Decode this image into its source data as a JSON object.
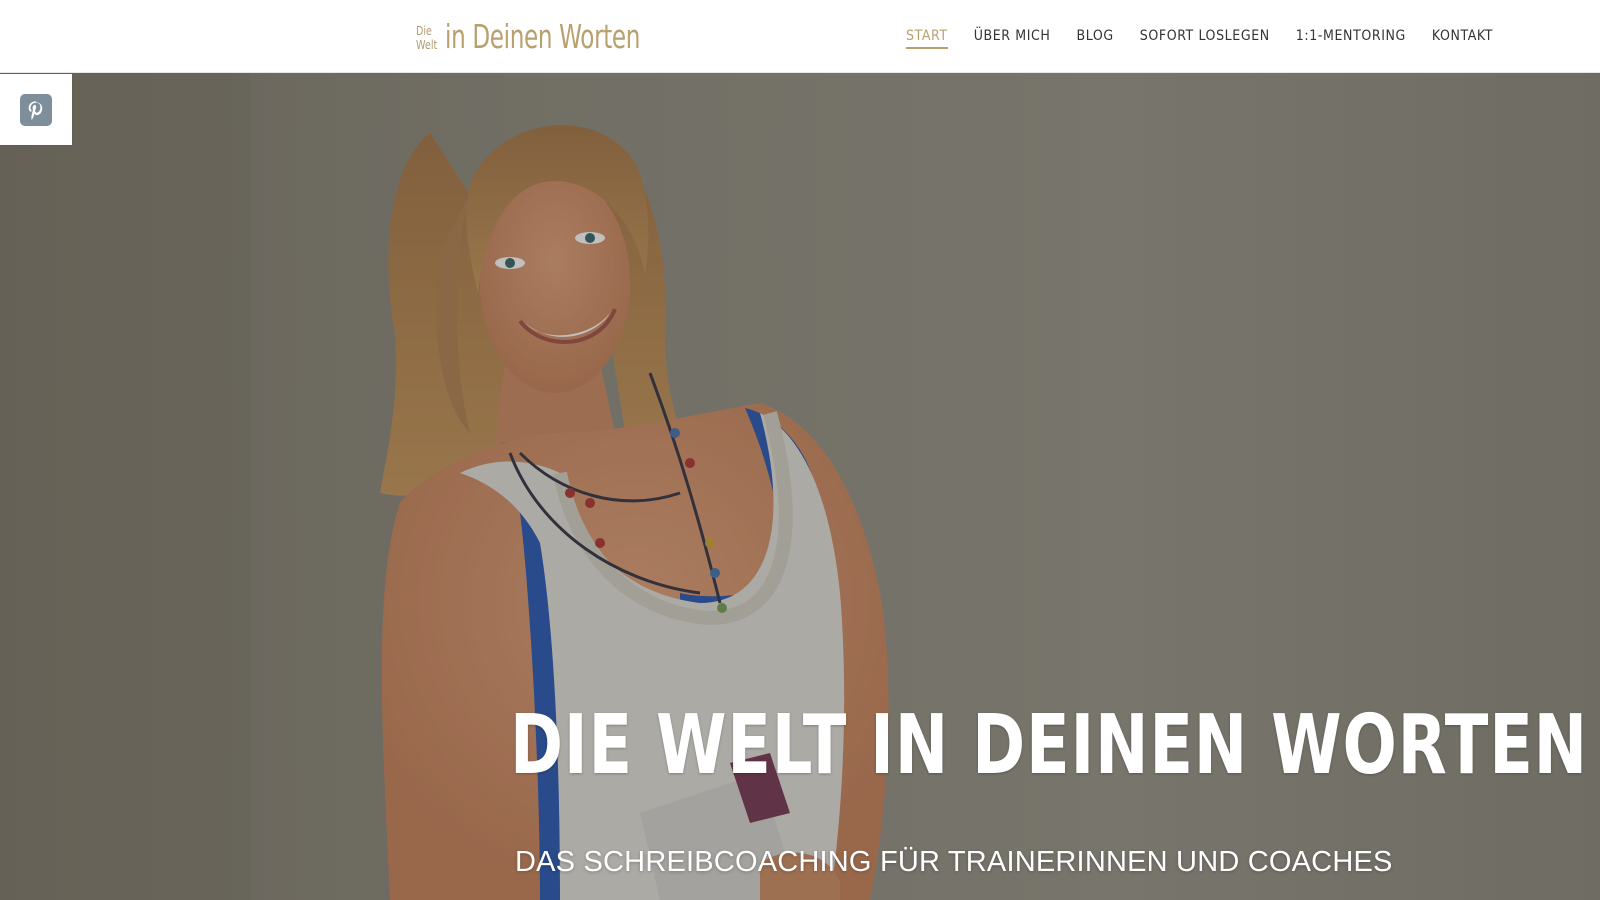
{
  "header": {
    "logo": {
      "small_line1": "Die",
      "small_line2": "Welt",
      "main": "in Deinen Worten"
    },
    "nav": [
      {
        "label": "START",
        "active": true
      },
      {
        "label": "ÜBER MICH",
        "active": false
      },
      {
        "label": "BLOG",
        "active": false
      },
      {
        "label": "SOFORT LOSLEGEN",
        "active": false
      },
      {
        "label": "1:1-MENTORING",
        "active": false
      },
      {
        "label": "KONTAKT",
        "active": false
      }
    ]
  },
  "share": {
    "icon": "pinterest-icon"
  },
  "hero": {
    "title": "DIE WELT IN DEINEN WORTEN",
    "subtitle": "DAS SCHREIBCOACHING FÜR TRAINERINNEN UND COACHES"
  },
  "colors": {
    "accent": "#b8a06f",
    "nav_text": "#333333",
    "hero_text": "#ffffff",
    "pinterest_icon_bg": "#7f8e9b"
  }
}
